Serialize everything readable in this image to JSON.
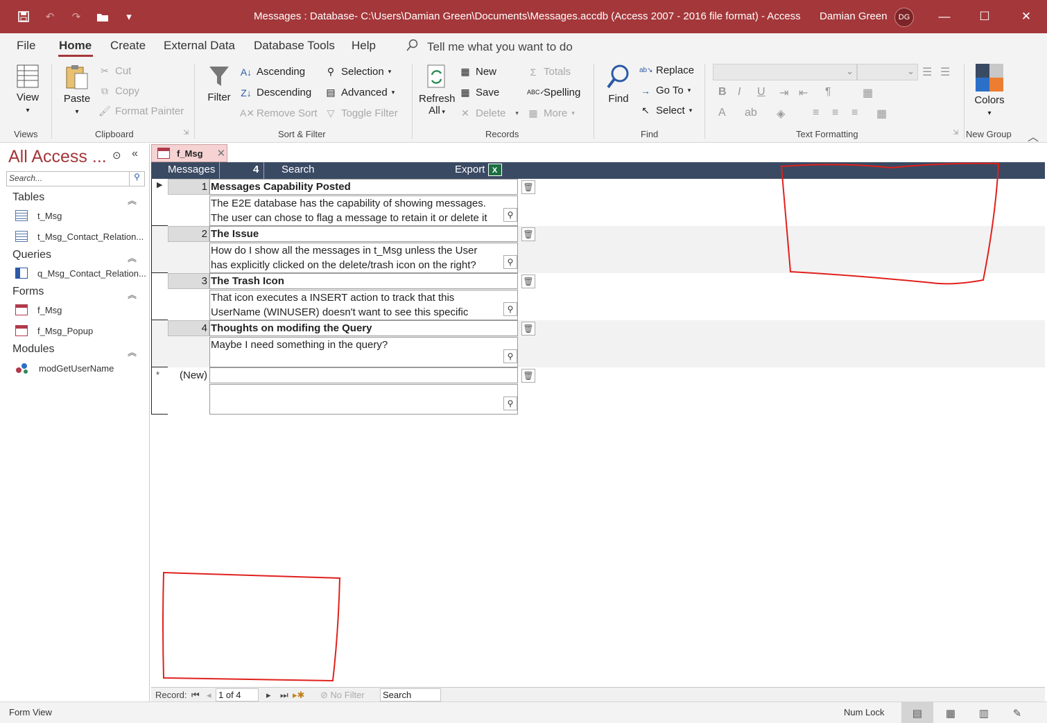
{
  "window": {
    "title": "Messages : Database- C:\\Users\\Damian Green\\Documents\\Messages.accdb (Access 2007 - 2016 file format)  -  Access",
    "user_name": "Damian Green",
    "user_initials": "DG"
  },
  "menu": {
    "tabs": [
      "File",
      "Home",
      "Create",
      "External Data",
      "Database Tools",
      "Help"
    ],
    "tell_me": "Tell me what you want to do"
  },
  "ribbon": {
    "views": {
      "view": "View",
      "group": "Views"
    },
    "clipboard": {
      "paste": "Paste",
      "cut": "Cut",
      "copy": "Copy",
      "format_painter": "Format Painter",
      "group": "Clipboard"
    },
    "sort_filter": {
      "filter": "Filter",
      "ascending": "Ascending",
      "descending": "Descending",
      "remove_sort": "Remove Sort",
      "selection": "Selection",
      "advanced": "Advanced",
      "toggle_filter": "Toggle Filter",
      "group": "Sort & Filter"
    },
    "records": {
      "refresh": "Refresh",
      "refresh_all": "All",
      "new": "New",
      "save": "Save",
      "delete": "Delete",
      "totals": "Totals",
      "spelling": "Spelling",
      "more": "More",
      "group": "Records"
    },
    "find": {
      "find": "Find",
      "replace": "Replace",
      "goto": "Go To",
      "select": "Select",
      "group": "Find"
    },
    "text_formatting": {
      "group": "Text Formatting"
    },
    "new_group": {
      "colors": "Colors",
      "group": "New Group"
    }
  },
  "nav_pane": {
    "title": "All Access ...",
    "search_placeholder": "Search...",
    "sections": [
      {
        "name": "Tables",
        "items": [
          "t_Msg",
          "t_Msg_Contact_Relation..."
        ]
      },
      {
        "name": "Queries",
        "items": [
          "q_Msg_Contact_Relation..."
        ]
      },
      {
        "name": "Forms",
        "items": [
          "f_Msg",
          "f_Msg_Popup"
        ]
      },
      {
        "name": "Modules",
        "items": [
          "modGetUserName"
        ]
      }
    ]
  },
  "document": {
    "tab": "f_Msg",
    "header": {
      "messages_label": "Messages",
      "count": "4",
      "search_label": "Search",
      "export_label": "Export",
      "excel_glyph": "X"
    },
    "records": [
      {
        "id": "1",
        "subject": "Messages Capability Posted",
        "body": "The E2E database has the capability of showing messages. The user can chose to flag a message to retain it or delete it"
      },
      {
        "id": "2",
        "subject": "The Issue",
        "body": "How do I show all the messages in t_Msg unless the User has explicitly clicked on the delete/trash icon on the right?"
      },
      {
        "id": "3",
        "subject": "The Trash Icon",
        "body": "That icon executes a INSERT action to track that this UserName (WINUSER) doesn't want to see this specific"
      },
      {
        "id": "4",
        "subject": "Thoughts on modifing the Query",
        "body": "Maybe I need something in the query?"
      }
    ],
    "new_row_label": "(New)",
    "new_row_marker": "*"
  },
  "record_nav": {
    "label": "Record:",
    "position": "1 of 4",
    "filter": "No Filter",
    "search": "Search"
  },
  "status": {
    "left": "Form View",
    "num_lock": "Num Lock"
  }
}
